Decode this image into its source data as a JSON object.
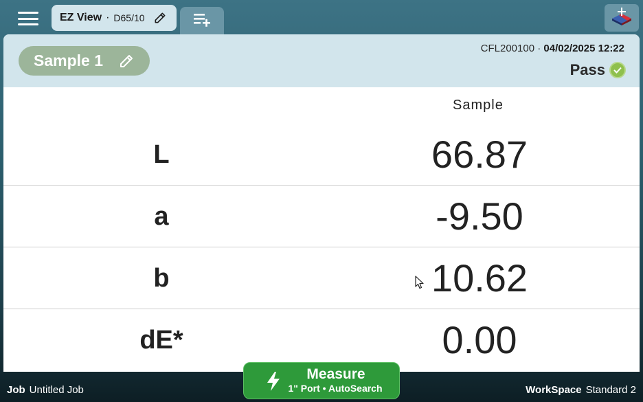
{
  "topbar": {
    "tab_name": "EZ View",
    "tab_sep": "·",
    "tab_illuminant": "D65/10",
    "icons": {
      "menu": "hamburger-menu-icon",
      "edit": "pencil-icon",
      "add_tab": "playlist-add-icon",
      "logo": "app-logo-icon"
    }
  },
  "header": {
    "sample_name": "Sample 1",
    "instrument": "CFL200100",
    "meta_sep": " · ",
    "datetime": "04/02/2025 12:22",
    "status": "Pass",
    "status_color": "#8fc04d"
  },
  "table": {
    "column_header": "Sample",
    "rows": [
      {
        "label": "L",
        "value": "66.87"
      },
      {
        "label": "a",
        "value": "-9.50"
      },
      {
        "label": "b",
        "value": "10.62"
      },
      {
        "label": "dE*",
        "value": "0.00"
      }
    ]
  },
  "footer": {
    "job_label": "Job",
    "job_value": "Untitled Job",
    "workspace_label": "WorkSpace",
    "workspace_value": "Standard 2"
  },
  "measure": {
    "title": "Measure",
    "subtitle": "1\" Port • AutoSearch",
    "color": "#2e9a3a"
  }
}
